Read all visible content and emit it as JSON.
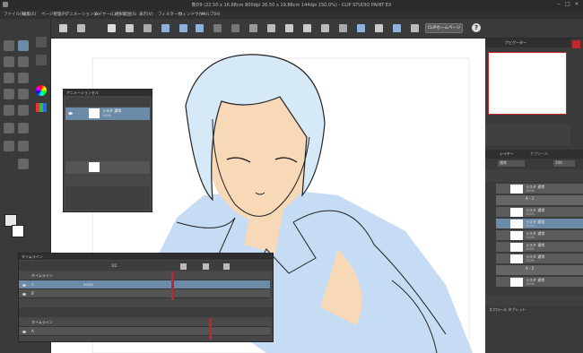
{
  "window": {
    "title": "熊D9 (22.50 x 16.88cm 800dpi 26.50 x 19.88cm 144dpi 150.0%) - CLIP STUDIO PAINT EX"
  },
  "menu": [
    "ファイル(F)",
    "編集(E)",
    "ページ管理(P)",
    "アニメーション(A)",
    "レイヤー(L)",
    "選択範囲(S)",
    "表示(V)",
    "フィルター(I)",
    "ウィンドウ(W)",
    "ヘルプ(H)"
  ],
  "command_bar": {
    "clip_button": "CLIPホームページ",
    "help_button": "?"
  },
  "navigator": {
    "title": "ナビゲーター"
  },
  "animation_cel_panel": {
    "title": "アニメーションセル",
    "layer_name": "ラスタ 通常",
    "layer_sub": "100%"
  },
  "layers_panel": {
    "tabs": [
      "レイヤー",
      "サブツール"
    ],
    "blend_mode": "通常",
    "opacity": "100",
    "rows": [
      {
        "name": "ラスタ 通常",
        "sub": "100%"
      },
      {
        "name": "A - 1",
        "sub": ""
      },
      {
        "name": "ラスタ 通常",
        "sub": "100%"
      },
      {
        "name": "ラスタ 通常",
        "sub": "100%"
      },
      {
        "name": "ラスタ 通常",
        "sub": "100%"
      },
      {
        "name": "ラスタ 通常",
        "sub": "100%"
      },
      {
        "name": "ラスタ 通常",
        "sub": "100%"
      },
      {
        "name": "A - 2",
        "sub": ""
      },
      {
        "name": "ラスタ 通常",
        "sub": "100%"
      }
    ]
  },
  "timeline": {
    "title": "タイムライン",
    "frame_display": "1/2",
    "tracks_top": [
      "タイムライン",
      "A",
      "B"
    ],
    "tracks_bottom": [
      "タイムライン",
      "A"
    ],
    "row_value": "00001"
  },
  "status_bar": {
    "bottom_right": "スクロール タブレット"
  },
  "colors": {
    "skin": "#f7d9b8",
    "shirt_blue": "#bcd6f2",
    "hair_blue": "#cfe6f7",
    "selected": "#6b8ba8",
    "playhead": "#c0272d"
  }
}
